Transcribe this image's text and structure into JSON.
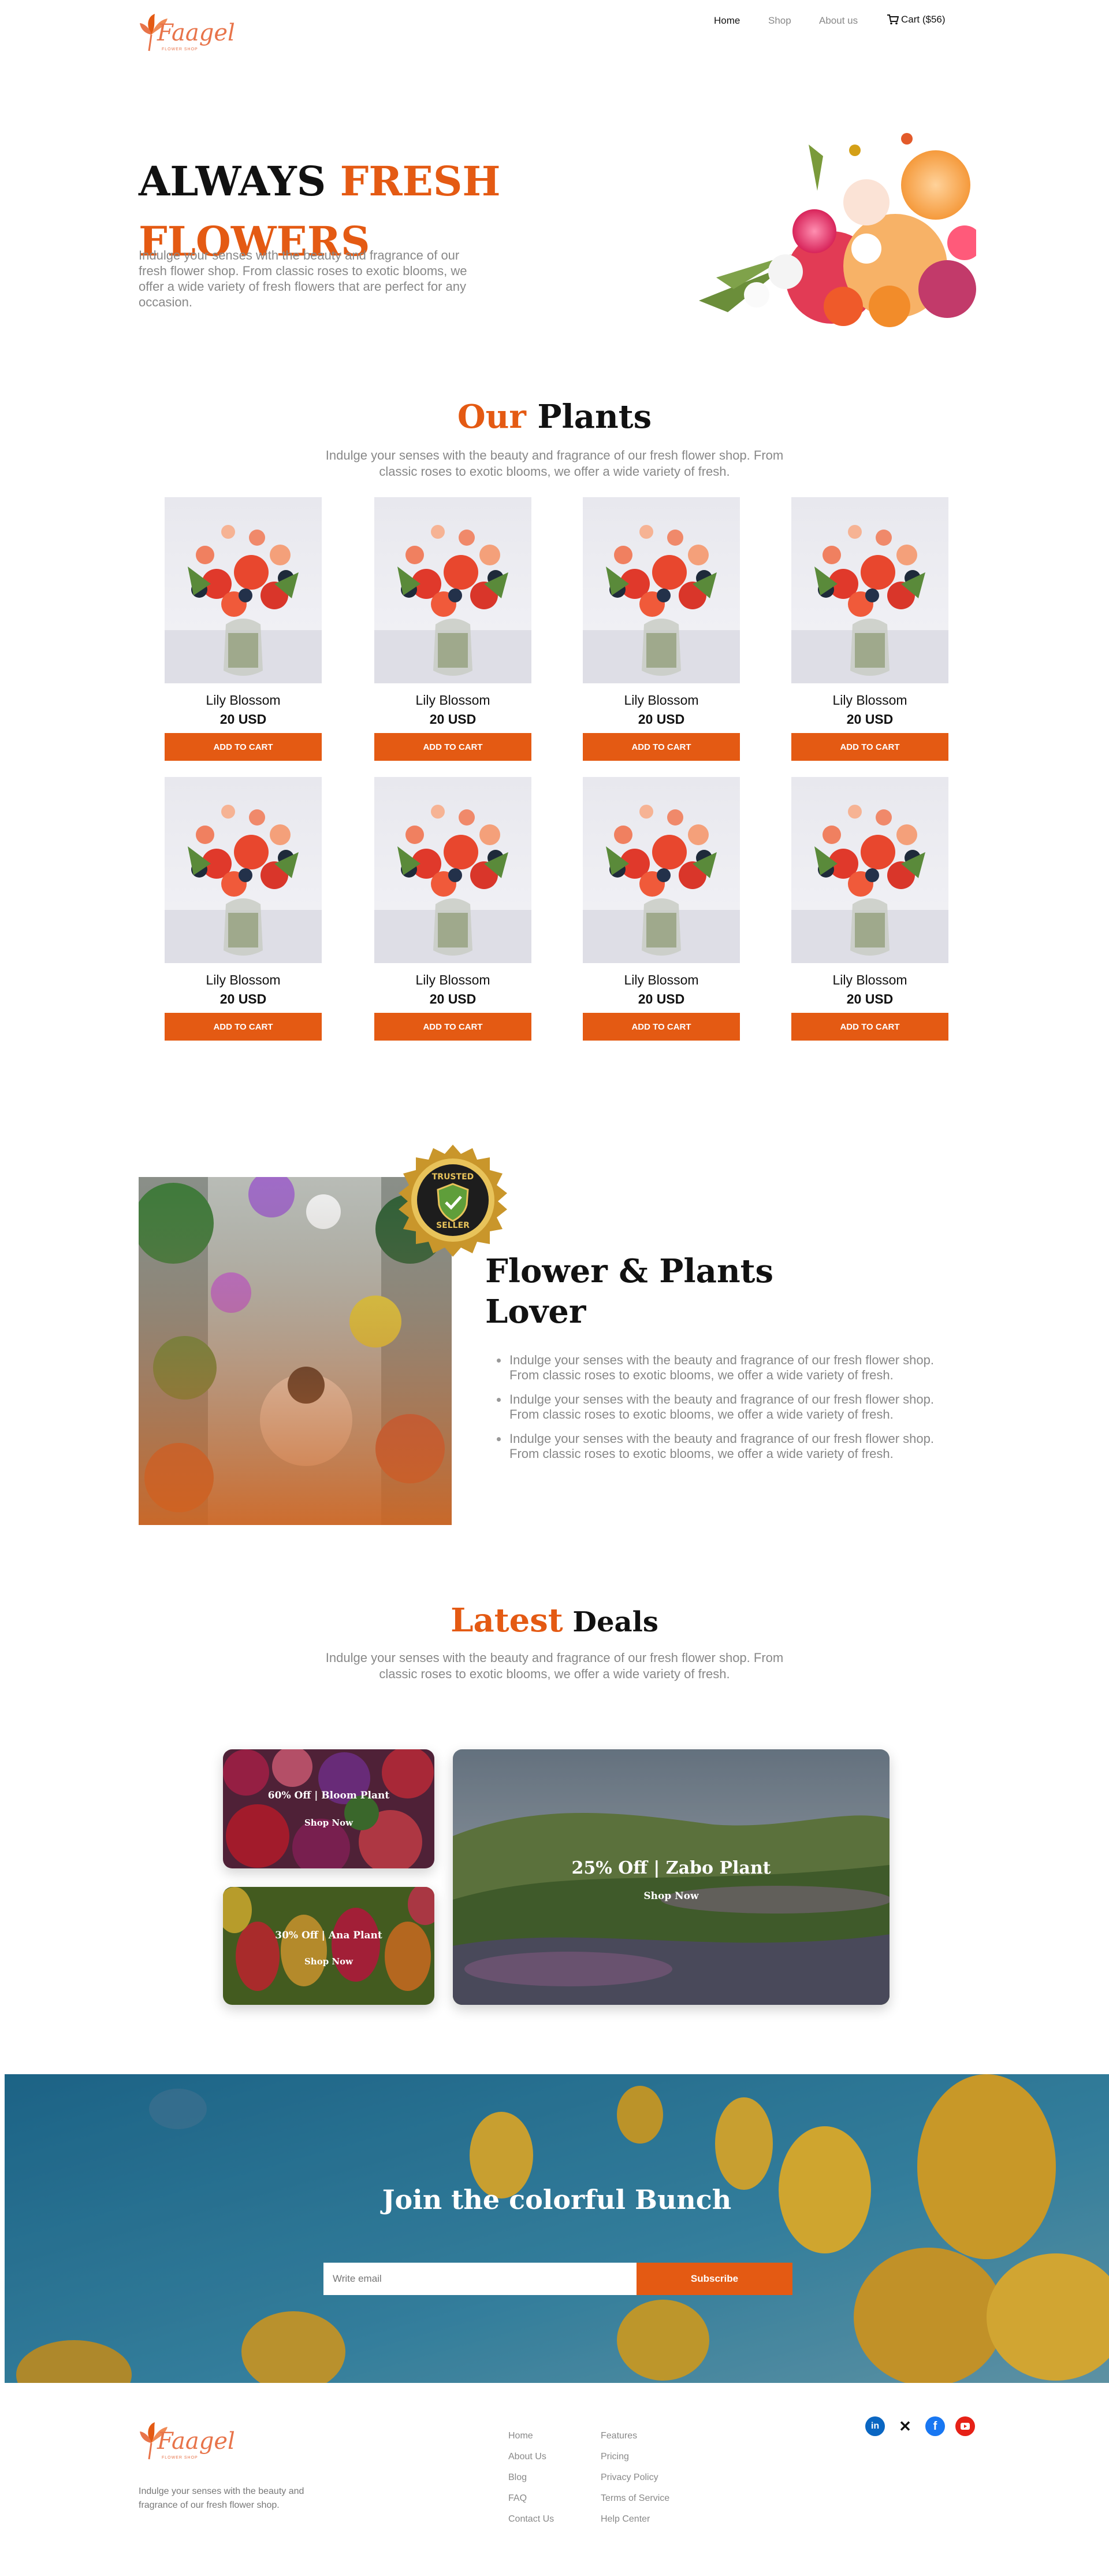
{
  "brand": {
    "logo_text": "Faagel",
    "logo_sub": "FLOWER SHOP"
  },
  "nav": {
    "home": "Home",
    "shop": "Shop",
    "about": "About us",
    "cart": "Cart ($56)"
  },
  "hero": {
    "title_black": "ALWAYS ",
    "title_orange_1": "FRESH",
    "title_orange_2": "FLOWERS",
    "description": "Indulge your senses with the beauty and fragrance of our fresh flower shop. From classic roses to exotic blooms, we offer a wide variety of fresh flowers that are perfect for any occasion."
  },
  "plants": {
    "title_orange": "Our",
    "title_black": " Plants",
    "description": "Indulge your senses with the beauty and fragrance of our fresh flower shop. From classic roses to exotic blooms, we offer a wide variety of fresh.",
    "products": [
      {
        "name": "Lily Blossom",
        "price": "20 USD",
        "button": "ADD TO CART"
      },
      {
        "name": "Lily Blossom",
        "price": "20 USD",
        "button": "ADD TO CART"
      },
      {
        "name": "Lily Blossom",
        "price": "20 USD",
        "button": "ADD TO CART"
      },
      {
        "name": "Lily Blossom",
        "price": "20 USD",
        "button": "ADD TO CART"
      },
      {
        "name": "Lily Blossom",
        "price": "20 USD",
        "button": "ADD TO CART"
      },
      {
        "name": "Lily Blossom",
        "price": "20 USD",
        "button": "ADD TO CART"
      },
      {
        "name": "Lily Blossom",
        "price": "20 USD",
        "button": "ADD TO CART"
      },
      {
        "name": "Lily Blossom",
        "price": "20 USD",
        "button": "ADD TO CART"
      }
    ]
  },
  "lover": {
    "badge_top": "TRUSTED",
    "badge_bottom": "SELLER",
    "title_line1": "Flower & Plants",
    "title_line2": "Lover",
    "bullets": [
      "Indulge your senses with the beauty and fragrance of our fresh flower shop. From classic roses to exotic blooms, we offer a wide variety of fresh.",
      "Indulge your senses with the beauty and fragrance of our fresh flower shop. From classic roses to exotic blooms, we offer a wide variety of fresh.",
      "Indulge your senses with the beauty and fragrance of our fresh flower shop. From classic roses to exotic blooms, we offer a wide variety of fresh."
    ]
  },
  "deals": {
    "title_orange": "Latest",
    "title_black": " Deals",
    "description": "Indulge your senses with the beauty and fragrance of our fresh flower shop. From classic roses to exotic blooms, we offer a wide variety of fresh.",
    "items": [
      {
        "title": "60% Off | Bloom Plant",
        "cta": "Shop Now"
      },
      {
        "title": "30% Off | Ana Plant",
        "cta": "Shop Now"
      },
      {
        "title": "25% Off | Zabo Plant",
        "cta": "Shop Now"
      }
    ]
  },
  "newsletter": {
    "title": "Join the colorful Bunch",
    "placeholder": "Write email",
    "button": "Subscribe"
  },
  "footer": {
    "description": "Indulge your senses with the beauty and fragrance of our fresh flower shop.",
    "col1": [
      "Home",
      "About Us",
      "Blog",
      "FAQ",
      "Contact Us"
    ],
    "col2": [
      "Features",
      "Pricing",
      "Privacy Policy",
      "Terms of Service",
      "Help Center"
    ],
    "social": [
      "linkedin-icon",
      "x-icon",
      "facebook-icon",
      "youtube-icon"
    ]
  },
  "colors": {
    "accent": "#e45a13"
  }
}
